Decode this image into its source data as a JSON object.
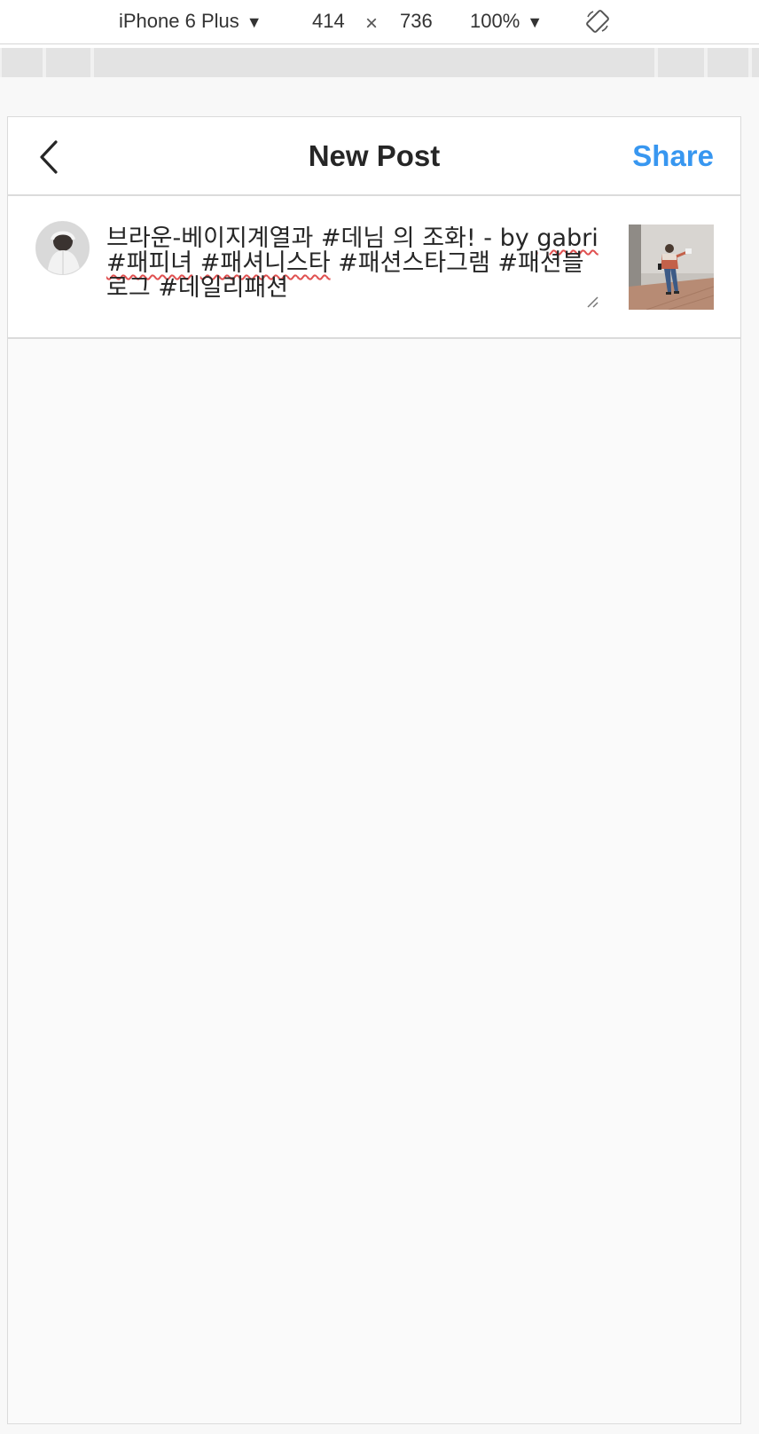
{
  "devtools": {
    "device": "iPhone 6 Plus",
    "dropdown_arrow": "▼",
    "width": "414",
    "times": "×",
    "height": "736",
    "zoom": "100%",
    "rotate_icon": "rotate-icon"
  },
  "header": {
    "back_icon": "chevron-left-icon",
    "title": "New Post",
    "share_label": "Share",
    "share_color": "#3897f0"
  },
  "compose": {
    "caption_line1": "브라운-베이지계열과 #데님 의 조화! - by ",
    "caption_username": "gabri",
    "caption_tags": [
      {
        "text": "#패피녀",
        "spell": true
      },
      {
        "text": " ",
        "spell": false
      },
      {
        "text": "#패셔니스타",
        "spell": true
      },
      {
        "text": " #패션스타그램 #패션블로그 #데일리패션",
        "spell": false
      }
    ]
  }
}
